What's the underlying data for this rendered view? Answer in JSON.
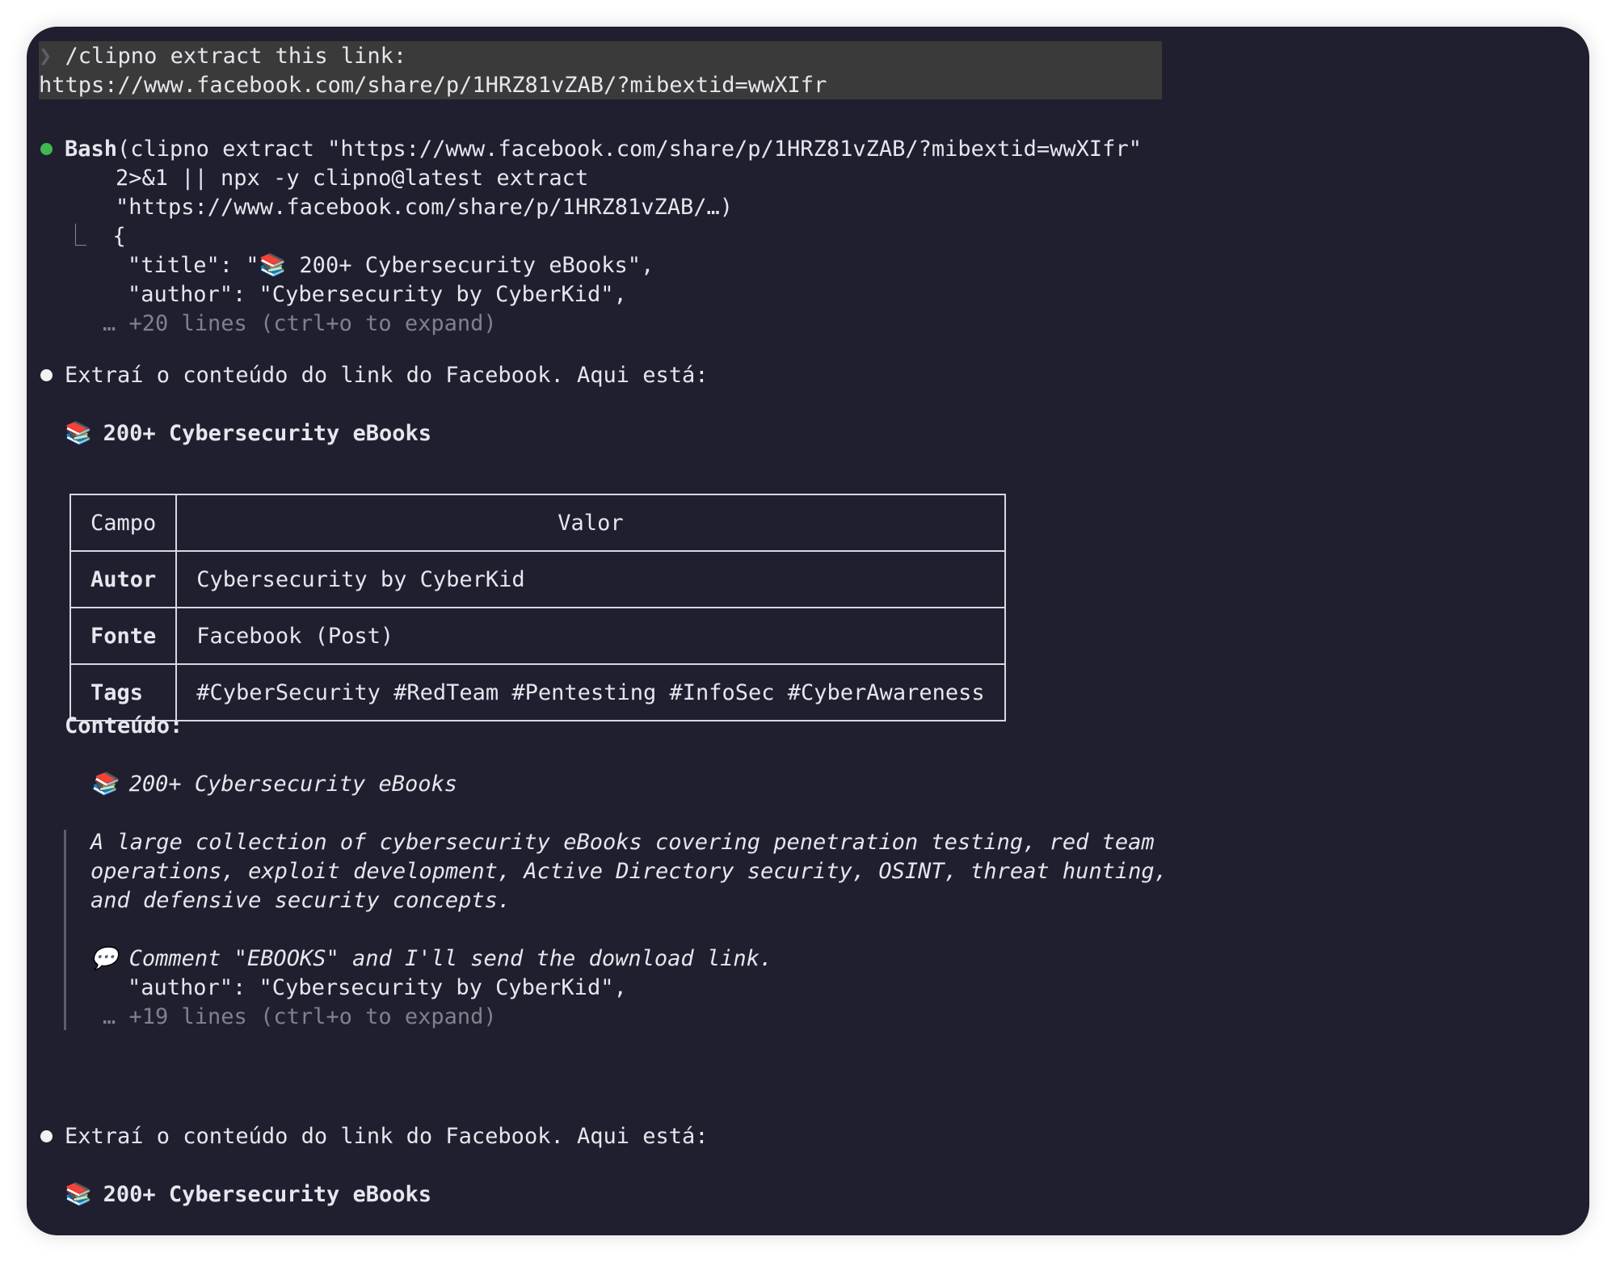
{
  "prompt": {
    "caret": "❯",
    "line1": "/clipno extract this link:",
    "line2": "https://www.facebook.com/share/p/1HRZ81vZAB/?mibextid=wwXIfr"
  },
  "bash": {
    "tool": "Bash",
    "cmd1": "(clipno extract \"https://www.facebook.com/share/p/1HRZ81vZAB/?mibextid=wwXIfr\"",
    "cmd2": "2>&1 || npx -y clipno@latest extract",
    "cmd3": "\"https://www.facebook.com/share/p/1HRZ81vZAB/…)",
    "tree": "⎿",
    "brace": "{",
    "out1": "\"title\": \"📚 200+ Cybersecurity eBooks\",",
    "out2": "\"author\": \"Cybersecurity by CyberKid\",",
    "more": "… +20 lines (ctrl+o to expand)"
  },
  "reply1": {
    "text": "Extraí o conteúdo do link do Facebook. Aqui está:",
    "emoji": "📚",
    "heading": "200+ Cybersecurity eBooks"
  },
  "table": {
    "headers": [
      "Campo",
      "Valor"
    ],
    "rows": [
      {
        "key": "Autor",
        "value": "Cybersecurity by CyberKid"
      },
      {
        "key": "Fonte",
        "value": "Facebook (Post)"
      },
      {
        "key": "Tags",
        "value": "#CyberSecurity #RedTeam #Pentesting #InfoSec #CyberAwareness"
      }
    ]
  },
  "content": {
    "label": "Conteúdo:",
    "emoji_books": "📚",
    "quote_title": "200+ Cybersecurity eBooks",
    "para1": "A large collection of cybersecurity eBooks covering penetration testing, red team",
    "para2": "operations, exploit development, Active Directory security, OSINT, threat hunting,",
    "para3": "and defensive security concepts.",
    "emoji_speech": "💬",
    "comment": "Comment \"EBOOKS\" and I'll send the download link.",
    "author_line": "\"author\": \"Cybersecurity by CyberKid\",",
    "more": "… +19 lines (ctrl+o to expand)"
  },
  "reply2": {
    "text": "Extraí o conteúdo do link do Facebook. Aqui está:",
    "emoji": "📚",
    "heading": "200+ Cybersecurity eBooks"
  },
  "colors": {
    "background": "#1f1f2f",
    "prompt_box": "#3a3a3a",
    "success_dot": "#3fb950",
    "text": "#e6e6ee",
    "dim": "#80808e"
  }
}
